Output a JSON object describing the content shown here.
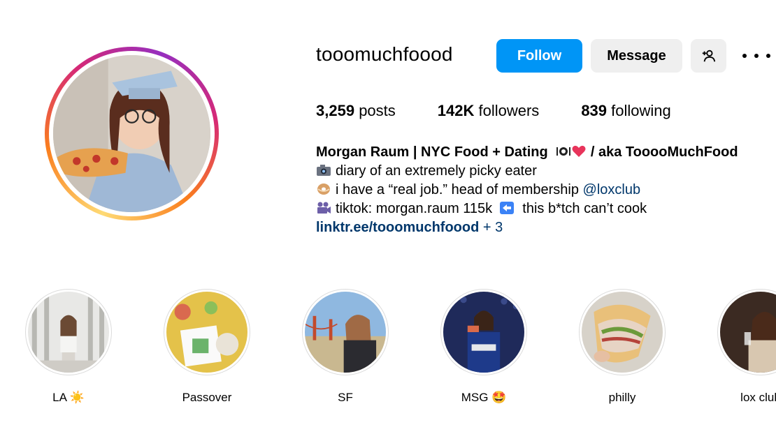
{
  "profile": {
    "username": "tooomuchfoood",
    "follow_label": "Follow",
    "message_label": "Message",
    "stats": {
      "posts_count": "3,259",
      "posts_label": "posts",
      "followers_count": "142K",
      "followers_label": "followers",
      "following_count": "839",
      "following_label": "following"
    },
    "bio": {
      "name": "Morgan Raum | NYC Food + Dating",
      "name_suffix": " / aka TooooMuchFood",
      "line1": "diary of an extremely picky eater",
      "line2_prefix": "i have a “real job.” head of membership ",
      "line2_mention": "@loxclub",
      "line3_prefix": "tiktok: morgan.raum 115k ",
      "line3_suffix": " this b*tch can’t cook",
      "link": "linktr.ee/tooomuchfoood",
      "link_more": " + 3"
    }
  },
  "highlights": [
    {
      "label": "LA ☀️"
    },
    {
      "label": "Passover"
    },
    {
      "label": "SF"
    },
    {
      "label": "MSG 🤩"
    },
    {
      "label": "philly"
    },
    {
      "label": "lox club"
    }
  ],
  "icons": {
    "follow": "follow-button",
    "add_user": "add-user-icon",
    "more": "more-options-icon",
    "camera": "camera-emoji-icon",
    "bagel": "bagel-emoji-icon",
    "video": "video-camera-emoji-icon",
    "arrow": "left-arrow-emoji-icon",
    "plate": "plate-emoji-icon",
    "heart": "heart-emoji-icon"
  },
  "colors": {
    "primary_button": "#0095f6",
    "secondary_button": "#efefef",
    "link": "#00376b"
  }
}
